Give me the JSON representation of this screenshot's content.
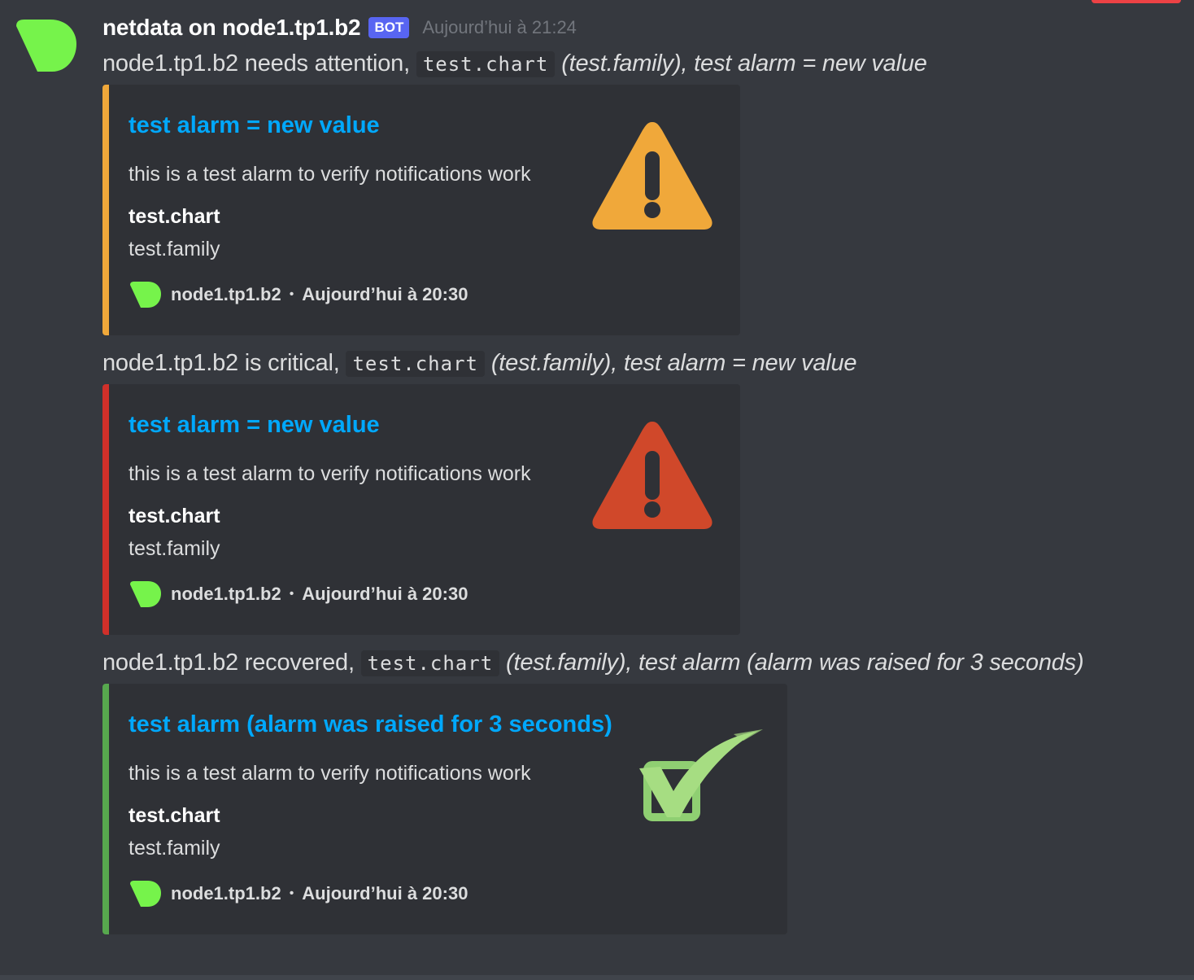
{
  "message": {
    "username": "netdata on node1.tp1.b2",
    "bot_tag": "BOT",
    "timestamp": "Aujourd’hui à 21:24"
  },
  "colors": {
    "warning": "#f0a83a",
    "critical": "#d0302a",
    "clear": "#57a84e",
    "title_link": "#00a8fc",
    "avatar_green": "#76f34b"
  },
  "notifications": [
    {
      "line": {
        "prefix": "node1.tp1.b2 needs attention,",
        "code": "test.chart",
        "family": "(test.family),",
        "alarm": "test alarm = new value"
      },
      "embed": {
        "status": "warning",
        "title": "test alarm = new value",
        "description": "this is a test alarm to verify notifications work",
        "field_name": "test.chart",
        "field_value": "test.family",
        "footer_host": "node1.tp1.b2",
        "footer_sep": "•",
        "footer_time": "Aujourd’hui à 20:30",
        "thumbnail_icon": "warning-triangle-icon"
      }
    },
    {
      "line": {
        "prefix": "node1.tp1.b2 is critical,",
        "code": "test.chart",
        "family": "(test.family),",
        "alarm": "test alarm = new value"
      },
      "embed": {
        "status": "critical",
        "title": "test alarm = new value",
        "description": "this is a test alarm to verify notifications work",
        "field_name": "test.chart",
        "field_value": "test.family",
        "footer_host": "node1.tp1.b2",
        "footer_sep": "•",
        "footer_time": "Aujourd’hui à 20:30",
        "thumbnail_icon": "critical-triangle-icon"
      }
    },
    {
      "line": {
        "prefix": "node1.tp1.b2 recovered,",
        "code": "test.chart",
        "family": "(test.family),",
        "alarm": "test alarm (alarm was raised for 3 seconds)"
      },
      "embed": {
        "status": "clear",
        "title": "test alarm (alarm was raised for 3 seconds)",
        "description": "this is a test alarm to verify notifications work",
        "field_name": "test.chart",
        "field_value": "test.family",
        "footer_host": "node1.tp1.b2",
        "footer_sep": "•",
        "footer_time": "Aujourd’hui à 20:30",
        "thumbnail_icon": "check-icon"
      }
    }
  ]
}
